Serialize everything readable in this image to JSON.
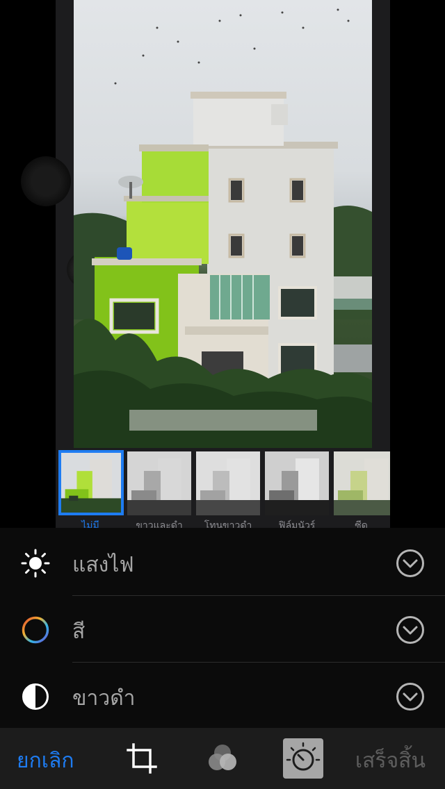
{
  "photo": {
    "description_icon": "house-photo"
  },
  "filters": [
    {
      "label": "ไม่มี",
      "active": true
    },
    {
      "label": "ขาวและดำ",
      "active": false
    },
    {
      "label": "โทนขาวดำ",
      "active": false
    },
    {
      "label": "ฟิล์มนัวร์",
      "active": false
    },
    {
      "label": "ซีด",
      "active": false
    }
  ],
  "adjustments": [
    {
      "label": "แสงไฟ",
      "icon": "sun-icon"
    },
    {
      "label": "สี",
      "icon": "color-wheel-icon"
    },
    {
      "label": "ขาวดำ",
      "icon": "half-circle-icon"
    }
  ],
  "toolbar": {
    "cancel_label": "ยกเลิก",
    "done_label": "เสร็จสิ้น",
    "tools": [
      "crop-icon",
      "filters-icon",
      "adjust-dial-icon"
    ]
  },
  "colors": {
    "accent": "#1e7cf2",
    "panel_bg": "#0b0b0b",
    "toolbar_bg": "#1c1c1c"
  }
}
